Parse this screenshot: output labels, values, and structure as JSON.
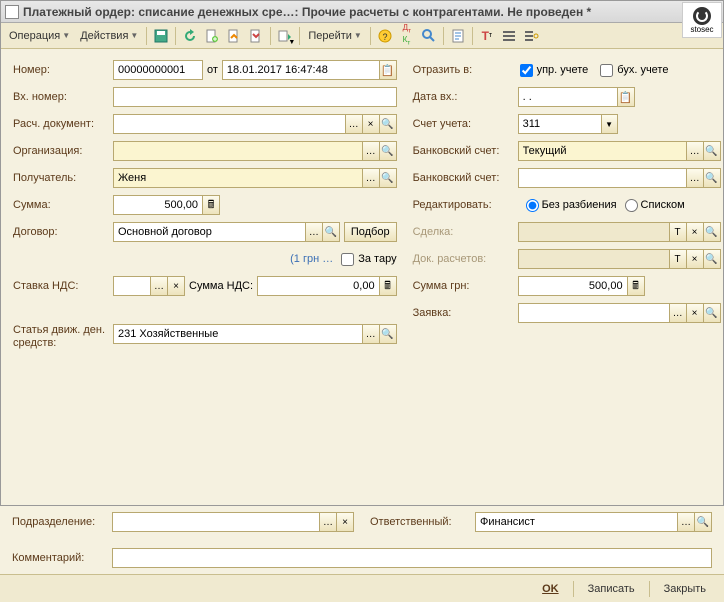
{
  "title": "Платежный ордер: списание денежных сре…: Прочие расчеты с контрагентами. Не проведен *",
  "watermark": "stosec",
  "toolbar": {
    "operation": "Операция",
    "actions": "Действия",
    "goto": "Перейти"
  },
  "labels": {
    "number": "Номер:",
    "from": "от",
    "in_number": "Вх. номер:",
    "calc_doc": "Расч. документ:",
    "org": "Организация:",
    "recipient": "Получатель:",
    "sum": "Сумма:",
    "contract": "Договор:",
    "podbor": "Подбор",
    "hint_1grn": "(1 грн …",
    "za_taru": "За тару",
    "vat_rate": "Ставка НДС:",
    "vat_sum": "Сумма НДС:",
    "article": "Статья движ. ден. средств:",
    "subdivision": "Подразделение:",
    "comment": "Комментарий:",
    "reflect_in": "Отразить в:",
    "upr": "упр. учете",
    "bukh": "бух. учете",
    "date_in": "Дата вх.:",
    "account": "Счет учета:",
    "bank_account": "Банковский счет:",
    "bank_account2": "Банковский счет:",
    "edit_mode": "Редактировать:",
    "no_split": "Без разбиения",
    "as_list": "Списком",
    "deal": "Сделка:",
    "doc_settle": "Док. расчетов:",
    "sum_grn": "Сумма грн:",
    "request": "Заявка:",
    "responsible": "Ответственный:"
  },
  "values": {
    "number": "00000000001",
    "date": "18.01.2017 16:47:48",
    "in_number": "",
    "calc_doc": "",
    "org": "",
    "recipient": "Женя",
    "sum": "500,00",
    "contract": "Основной договор",
    "vat_rate": "",
    "vat_sum": "0,00",
    "article": "231 Хозяйственные",
    "subdivision": "",
    "comment": "",
    "upr_checked": true,
    "bukh_checked": false,
    "date_in": ". .",
    "account": "311",
    "bank_account": "Текущий",
    "bank_account2": "",
    "edit_no_split": true,
    "edit_as_list": false,
    "deal": "",
    "doc_settle": "",
    "sum_grn": "500,00",
    "request": "",
    "responsible": "Финансист"
  },
  "footer": {
    "ok": "OK",
    "write": "Записать",
    "close": "Закрыть"
  }
}
